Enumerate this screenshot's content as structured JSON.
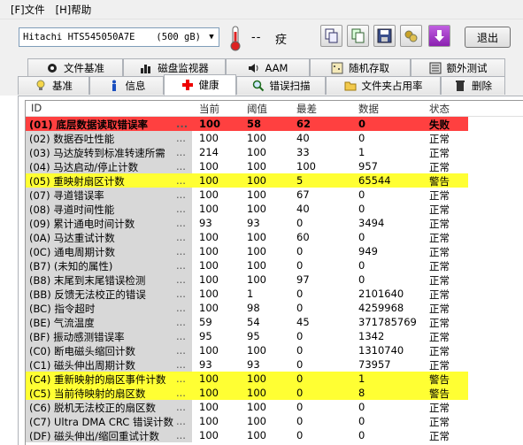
{
  "menu": [
    {
      "label": "[F]文件"
    },
    {
      "label": "[H]帮助"
    }
  ],
  "drive": {
    "name": "Hitachi HTS545050A7E",
    "size": "(500 gB)"
  },
  "temperature": {
    "value": "--",
    "status_glyph": "㽴"
  },
  "toolbar": {
    "exit_label": "退出"
  },
  "tabs_top": [
    {
      "label": "文件基准"
    },
    {
      "label": "磁盘监视器"
    },
    {
      "label": "AAM"
    },
    {
      "label": "随机存取"
    },
    {
      "label": "额外测试"
    }
  ],
  "tabs_bottom": [
    {
      "label": "基准"
    },
    {
      "label": "信息"
    },
    {
      "label": "健康"
    },
    {
      "label": "错误扫描"
    },
    {
      "label": "文件夹占用率"
    },
    {
      "label": "删除"
    }
  ],
  "table": {
    "headers": {
      "id": "ID",
      "current": "当前",
      "threshold": "阈值",
      "worst": "最差",
      "data": "数据",
      "status": "状态"
    },
    "rows": [
      {
        "id": "(01) 底层数据读取错误率",
        "cur": "100",
        "thr": "58",
        "worst": "62",
        "data": "0",
        "status": "失败",
        "hl": "red"
      },
      {
        "id": "(02) 数据吞吐性能",
        "cur": "100",
        "thr": "100",
        "worst": "40",
        "data": "0",
        "status": "正常",
        "hl": ""
      },
      {
        "id": "(03) 马达旋转到标准转速所需",
        "cur": "214",
        "thr": "100",
        "worst": "33",
        "data": "1",
        "status": "正常",
        "hl": ""
      },
      {
        "id": "(04) 马达启动/停止计数",
        "cur": "100",
        "thr": "100",
        "worst": "100",
        "data": "957",
        "status": "正常",
        "hl": ""
      },
      {
        "id": "(05) 重映射扇区计数",
        "cur": "100",
        "thr": "100",
        "worst": "5",
        "data": "65544",
        "status": "警告",
        "hl": "yellow"
      },
      {
        "id": "(07) 寻道错误率",
        "cur": "100",
        "thr": "100",
        "worst": "67",
        "data": "0",
        "status": "正常",
        "hl": ""
      },
      {
        "id": "(08) 寻道时间性能",
        "cur": "100",
        "thr": "100",
        "worst": "40",
        "data": "0",
        "status": "正常",
        "hl": ""
      },
      {
        "id": "(09) 累计通电时间计数",
        "cur": "93",
        "thr": "93",
        "worst": "0",
        "data": "3494",
        "status": "正常",
        "hl": ""
      },
      {
        "id": "(0A) 马达重试计数",
        "cur": "100",
        "thr": "100",
        "worst": "60",
        "data": "0",
        "status": "正常",
        "hl": ""
      },
      {
        "id": "(0C) 通电周期计数",
        "cur": "100",
        "thr": "100",
        "worst": "0",
        "data": "949",
        "status": "正常",
        "hl": ""
      },
      {
        "id": "(B7) (未知的属性)",
        "cur": "100",
        "thr": "100",
        "worst": "0",
        "data": "0",
        "status": "正常",
        "hl": ""
      },
      {
        "id": "(B8) 末尾到末尾错误检测",
        "cur": "100",
        "thr": "100",
        "worst": "97",
        "data": "0",
        "status": "正常",
        "hl": ""
      },
      {
        "id": "(BB) 反馈无法校正的错误",
        "cur": "100",
        "thr": "1",
        "worst": "0",
        "data": "2101640",
        "status": "正常",
        "hl": ""
      },
      {
        "id": "(BC) 指令超时",
        "cur": "100",
        "thr": "98",
        "worst": "0",
        "data": "4259968",
        "status": "正常",
        "hl": ""
      },
      {
        "id": "(BE) 气流温度",
        "cur": "59",
        "thr": "54",
        "worst": "45",
        "data": "371785769",
        "status": "正常",
        "hl": ""
      },
      {
        "id": "(BF) 振动感测错误率",
        "cur": "95",
        "thr": "95",
        "worst": "0",
        "data": "1342",
        "status": "正常",
        "hl": ""
      },
      {
        "id": "(C0) 断电磁头缩回计数",
        "cur": "100",
        "thr": "100",
        "worst": "0",
        "data": "1310740",
        "status": "正常",
        "hl": ""
      },
      {
        "id": "(C1) 磁头伸出周期计数",
        "cur": "93",
        "thr": "93",
        "worst": "0",
        "data": "73957",
        "status": "正常",
        "hl": ""
      },
      {
        "id": "(C4) 重新映射的扇区事件计数",
        "cur": "100",
        "thr": "100",
        "worst": "0",
        "data": "1",
        "status": "警告",
        "hl": "yellow"
      },
      {
        "id": "(C5) 当前待映射的扇区数",
        "cur": "100",
        "thr": "100",
        "worst": "0",
        "data": "8",
        "status": "警告",
        "hl": "yellow"
      },
      {
        "id": "(C6) 脱机无法校正的扇区数",
        "cur": "100",
        "thr": "100",
        "worst": "0",
        "data": "0",
        "status": "正常",
        "hl": ""
      },
      {
        "id": "(C7) Ultra DMA CRC 错误计数",
        "cur": "100",
        "thr": "100",
        "worst": "0",
        "data": "0",
        "status": "正常",
        "hl": ""
      },
      {
        "id": "(DF) 磁头伸出/缩回重试计数",
        "cur": "100",
        "thr": "100",
        "worst": "0",
        "data": "0",
        "status": "正常",
        "hl": ""
      }
    ],
    "dots": "..."
  },
  "colors": {
    "fail": "#ff4040",
    "warn": "#ffff33",
    "idcell": "#d8d8d8"
  }
}
